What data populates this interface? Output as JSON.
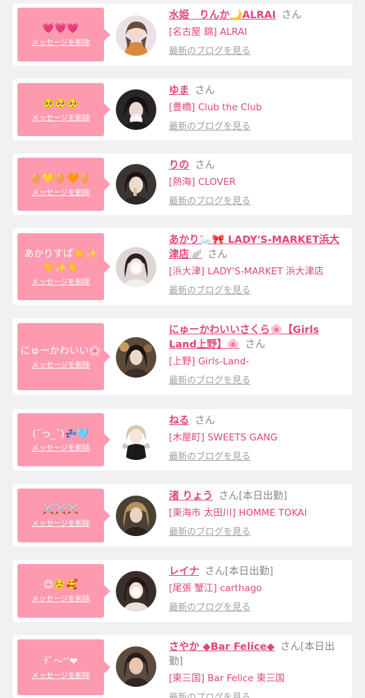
{
  "common": {
    "delete_label": "メッセージを削除",
    "blog_label": "最新のブログを見る",
    "san": "さん"
  },
  "colors": {
    "bubble": "#fe9ab0",
    "name": "#e2457a",
    "muted": "#a0a0a0",
    "background": "#f1f1f1"
  },
  "messages": [
    {
      "bubble_text": "💗💗💗",
      "name": "水姫　りんか🌙ALRAI",
      "status": "",
      "shop": "[名古屋 錦] ALRAI"
    },
    {
      "bubble_text": "🥺🥺🥺",
      "name": "ゆま",
      "status": "",
      "shop": "[豊橋] Club the Club"
    },
    {
      "bubble_text": "🥚💛🥚🧡🥚",
      "name": "りの",
      "status": "",
      "shop": "[熱海] CLOVER"
    },
    {
      "bubble_text": "あかりすぱ☀️✨☀️✨☀️",
      "name": "あかり🦢🎀 LADY'S-MARKET浜大津店🪽",
      "status": "",
      "shop": "[浜大津] LADY'S-MARKET 浜大津店"
    },
    {
      "bubble_text": "にゅーかわいい🌸",
      "name": "にゅーかわいいさくら🌸【Girls Land上野】🌸",
      "status": "",
      "shop": "[上野] Girls-Land-"
    },
    {
      "bubble_text": "(˘っ_˘)💤🩵",
      "name": "ねる",
      "status": "",
      "shop": "[木屋町] SWEETS GANG"
    },
    {
      "bubble_text": "⚔️⚔️⚔️",
      "name": "渚 りょう",
      "status": "[本日出勤]",
      "shop": "[東海市 太田川] HOMME TOKAI"
    },
    {
      "bubble_text": "😊☺️🥰",
      "name": "レイナ",
      "status": "[本日出勤]",
      "shop": "[尾張 蟹江] carthago"
    },
    {
      "bubble_text": "ﾃﾞ〜‘’❤︎",
      "name": "さやか ◆Bar Felice◆",
      "status": "[本日出勤]",
      "shop": "[東三国] Bar Felice 東三国"
    }
  ]
}
